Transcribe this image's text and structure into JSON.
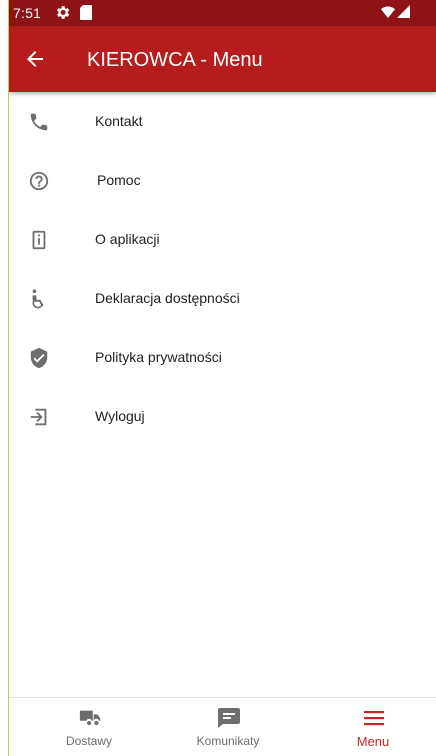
{
  "status_bar": {
    "time": "7:51",
    "icons": [
      "settings-icon",
      "sd-card-icon",
      "wifi-icon",
      "signal-icon"
    ]
  },
  "app_bar": {
    "title": "KIEROWCA - Menu",
    "back_icon": "arrow-back-icon"
  },
  "menu": {
    "items": [
      {
        "label": "Kontakt",
        "icon": "phone-icon"
      },
      {
        "label": "Pomoc",
        "icon": "help-circle-icon"
      },
      {
        "label": "O aplikacji",
        "icon": "info-device-icon"
      },
      {
        "label": "Deklaracja dostępności",
        "icon": "accessibility-icon"
      },
      {
        "label": "Polityka prywatności",
        "icon": "shield-check-icon"
      },
      {
        "label": "Wyloguj",
        "icon": "logout-icon"
      }
    ]
  },
  "bottom_nav": {
    "tabs": [
      {
        "label": "Dostawy",
        "icon": "truck-icon",
        "active": false
      },
      {
        "label": "Komunikaty",
        "icon": "message-icon",
        "active": false
      },
      {
        "label": "Menu",
        "icon": "menu-icon",
        "active": true
      }
    ]
  },
  "colors": {
    "status_bar": "#8e1317",
    "app_bar": "#b71c1c",
    "accent": "#c62828",
    "icon_gray": "#6e6e6e",
    "text": "#222222"
  }
}
